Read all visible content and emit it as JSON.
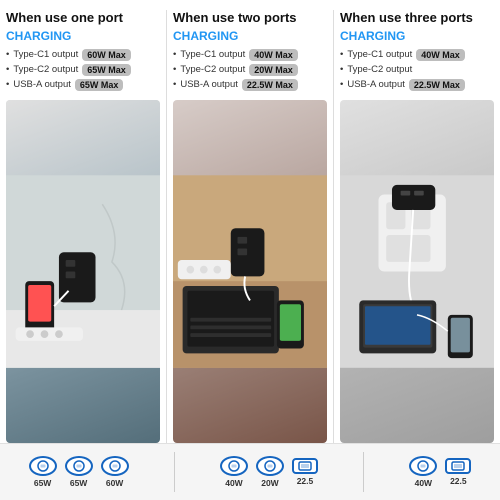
{
  "columns": [
    {
      "id": "one-port",
      "title": "When use one port",
      "charging_label": "CHARGING",
      "specs": [
        {
          "port": "Type-C1",
          "type": "output",
          "badge": "60W Max"
        },
        {
          "port": "Type-C2",
          "type": "output",
          "badge": "65W Max"
        },
        {
          "port": "USB-A",
          "type": "output",
          "badge": "65W Max"
        }
      ],
      "bottom_ports": [
        {
          "label": "65W",
          "kind": "usbc"
        },
        {
          "label": "65W",
          "kind": "usbc"
        },
        {
          "label": "60W",
          "kind": "usbc"
        }
      ]
    },
    {
      "id": "two-ports",
      "title": "When use two ports",
      "charging_label": "CHARGING",
      "specs": [
        {
          "port": "Type-C1",
          "type": "output",
          "badge": "40W Max"
        },
        {
          "port": "Type-C2",
          "type": "output",
          "badge": "20W Max"
        },
        {
          "port": "USB-A",
          "type": "output",
          "badge": "22.5W Max"
        }
      ],
      "bottom_ports": [
        {
          "label": "40W",
          "kind": "usbc"
        },
        {
          "label": "20W",
          "kind": "usbc"
        },
        {
          "label": "22.5",
          "kind": "usba"
        }
      ]
    },
    {
      "id": "three-ports",
      "title": "When use three ports",
      "charging_label": "CHARGING",
      "specs": [
        {
          "port": "Type-C1",
          "type": "output",
          "badge": "40W Max"
        },
        {
          "port": "Type-C2",
          "type": "output",
          "badge": ""
        },
        {
          "port": "USB-A",
          "type": "output",
          "badge": "22.5W Max"
        }
      ],
      "bottom_ports": [
        {
          "label": "40W",
          "kind": "usbc"
        },
        {
          "label": "22.5",
          "kind": "usba"
        }
      ]
    }
  ],
  "accent_color": "#2196f3",
  "badge_color": "#bdbdbd"
}
